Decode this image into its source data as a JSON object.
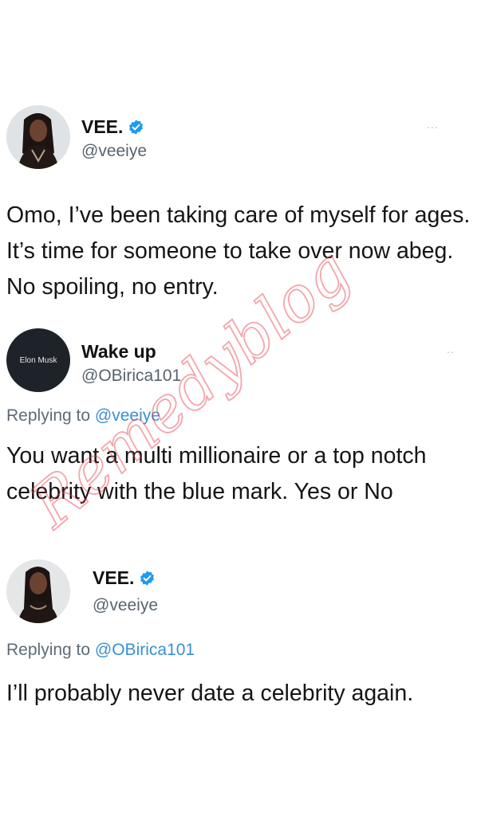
{
  "tweet1": {
    "name": "VEE.",
    "handle": "@veeiye",
    "more": "...",
    "text": "Omo, I’ve been taking care of myself for ages. It’s time for someone to take over now abeg. No spoiling, no entry."
  },
  "tweet2": {
    "avatar_text": "Elon Musk",
    "name": "Wake up",
    "handle": "@OBirica101",
    "more": "..",
    "reply_prefix": "Replying to ",
    "reply_mention": "@veeiye",
    "text": "You want a multi millionaire or a top notch celebrity with the blue mark. Yes or No"
  },
  "tweet3": {
    "name": "VEE.",
    "handle": "@veeiye",
    "reply_prefix": "Replying to ",
    "reply_mention": "@OBirica101",
    "text": "I’ll probably never date a celebrity again."
  },
  "watermark": "Remedyblog",
  "colors": {
    "verified": "#1d9bf0",
    "mention": "#3a8fd6",
    "watermark": "#e63a46"
  }
}
